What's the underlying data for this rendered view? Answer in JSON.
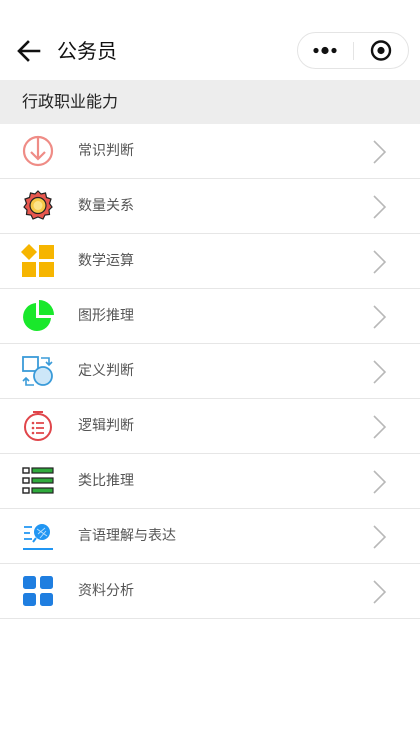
{
  "navbar": {
    "title": "公务员",
    "back_icon": "arrow-left-icon",
    "more_icon": "more-dots-icon",
    "close_icon": "target-close-icon"
  },
  "section": {
    "title": "行政职业能力"
  },
  "categories": [
    {
      "label": "常识判断",
      "icon": "circle-down-arrow-icon",
      "color": "#ef8c86"
    },
    {
      "label": "数量关系",
      "icon": "award-medal-icon",
      "color": "#f5a623"
    },
    {
      "label": "数学运算",
      "icon": "grid-diamond-icon",
      "color": "#f6b500"
    },
    {
      "label": "图形推理",
      "icon": "pie-chart-icon",
      "color": "#19e82b"
    },
    {
      "label": "定义判断",
      "icon": "sync-shapes-icon",
      "color": "#3a9bd9"
    },
    {
      "label": "逻辑判断",
      "icon": "alarm-list-icon",
      "color": "#e0454a"
    },
    {
      "label": "类比推理",
      "icon": "checklist-icon",
      "color": "#2faa3c"
    },
    {
      "label": "言语理解与表达",
      "icon": "search-text-icon",
      "color": "#2196f3"
    },
    {
      "label": "资料分析",
      "icon": "four-squares-icon",
      "color": "#1f7ee0"
    }
  ]
}
